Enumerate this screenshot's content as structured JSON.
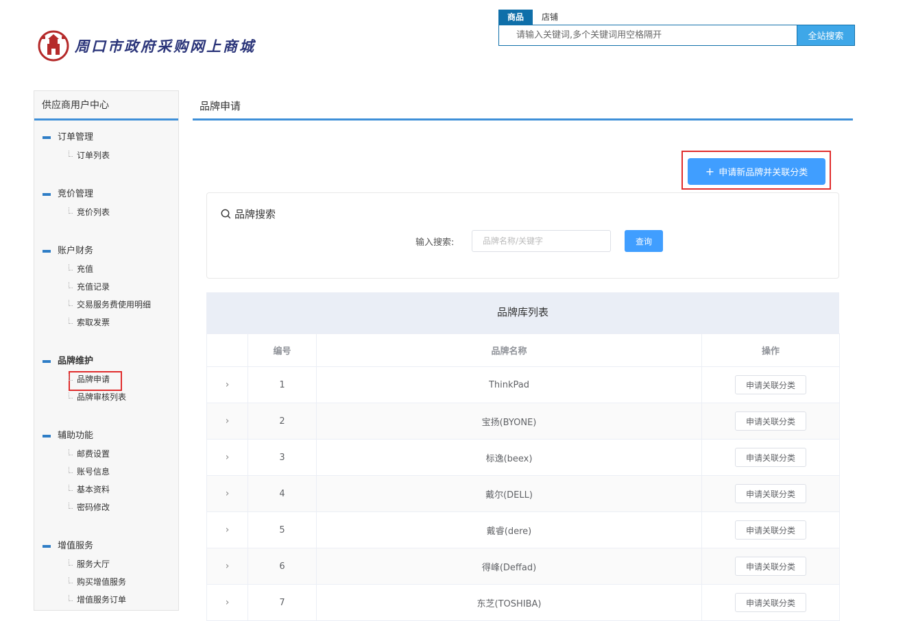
{
  "header": {
    "site_title": "周口市政府采购网上商城",
    "search": {
      "tabs": [
        {
          "label": "商品",
          "active": true
        },
        {
          "label": "店铺",
          "active": false
        }
      ],
      "placeholder": "请输入关键词,多个关键词用空格隔开",
      "button_label": "全站搜索"
    }
  },
  "sidebar": {
    "title": "供应商用户中心",
    "groups": [
      {
        "title": "订单管理",
        "items": [
          "订单列表"
        ]
      },
      {
        "title": "竞价管理",
        "items": [
          "竞价列表"
        ]
      },
      {
        "title": "账户财务",
        "items": [
          "充值",
          "充值记录",
          "交易服务费使用明细",
          "索取发票"
        ]
      },
      {
        "title": "品牌维护",
        "items": [
          "品牌申请",
          "品牌审核列表"
        ],
        "active_item": "品牌申请"
      },
      {
        "title": "辅助功能",
        "items": [
          "邮费设置",
          "账号信息",
          "基本资料",
          "密码修改"
        ]
      },
      {
        "title": "增值服务",
        "items": [
          "服务大厅",
          "购买增值服务",
          "增值服务订单"
        ]
      }
    ]
  },
  "main": {
    "page_title": "品牌申请",
    "apply_button": "申请新品牌并关联分类",
    "search_card": {
      "title": "品牌搜索",
      "label": "输入搜索:",
      "placeholder": "品牌名称/关键字",
      "button": "查询"
    },
    "table": {
      "title": "品牌库列表",
      "columns": [
        "",
        "编号",
        "品牌名称",
        "操作"
      ],
      "action_label": "申请关联分类",
      "rows": [
        {
          "id": "1",
          "name": "ThinkPad"
        },
        {
          "id": "2",
          "name": "宝扬(BYONE)"
        },
        {
          "id": "3",
          "name": "标逸(beex)"
        },
        {
          "id": "4",
          "name": "戴尔(DELL)"
        },
        {
          "id": "5",
          "name": "戴睿(dere)"
        },
        {
          "id": "6",
          "name": "得峰(Deffad)"
        },
        {
          "id": "7",
          "name": "东芝(TOSHIBA)"
        }
      ]
    }
  },
  "colors": {
    "accent": "#409eff",
    "nav_blue": "#2e7dc6",
    "highlight_red": "#e02b2b"
  }
}
